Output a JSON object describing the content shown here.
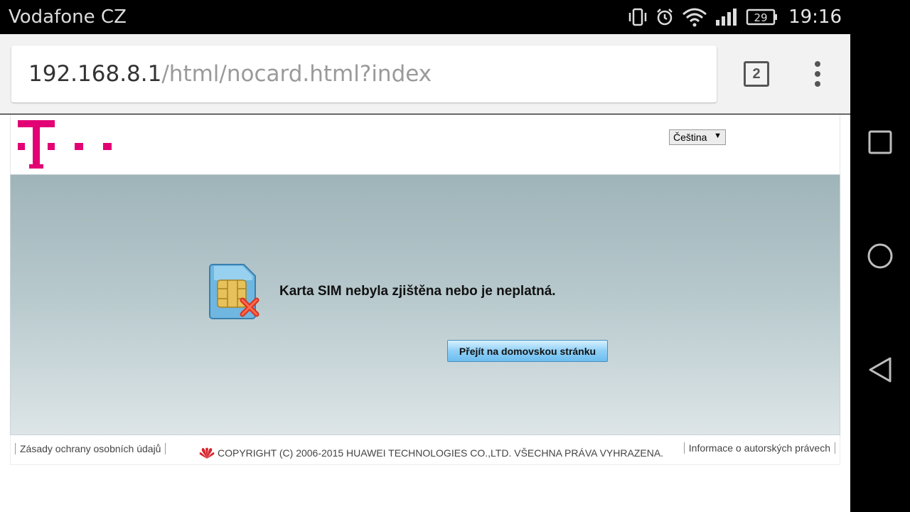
{
  "status_bar": {
    "carrier": "Vodafone CZ",
    "battery": "29",
    "time": "19:16",
    "icons": [
      "vibrate-icon",
      "alarm-icon",
      "wifi-icon",
      "signal-icon",
      "battery-icon"
    ]
  },
  "browser": {
    "url_host": "192.168.8.1",
    "url_path": "/html/nocard.html?index",
    "tab_count": "2"
  },
  "header": {
    "language": "Čeština",
    "brand_color": "#e20074"
  },
  "main": {
    "message": "Karta SIM nebyla zjištěna nebo je neplatná.",
    "home_button": "Přejít na domovskou stránku"
  },
  "footer": {
    "privacy_link": "Zásady ochrany osobních údajů",
    "copyright": "COPYRIGHT (C) 2006-2015 HUAWEI TECHNOLOGIES CO.,LTD. VŠECHNA PRÁVA VYHRAZENA.",
    "copyright_link": "Informace o autorských právech"
  },
  "navigation": {
    "buttons": [
      "recents-icon",
      "home-icon",
      "back-icon"
    ]
  }
}
